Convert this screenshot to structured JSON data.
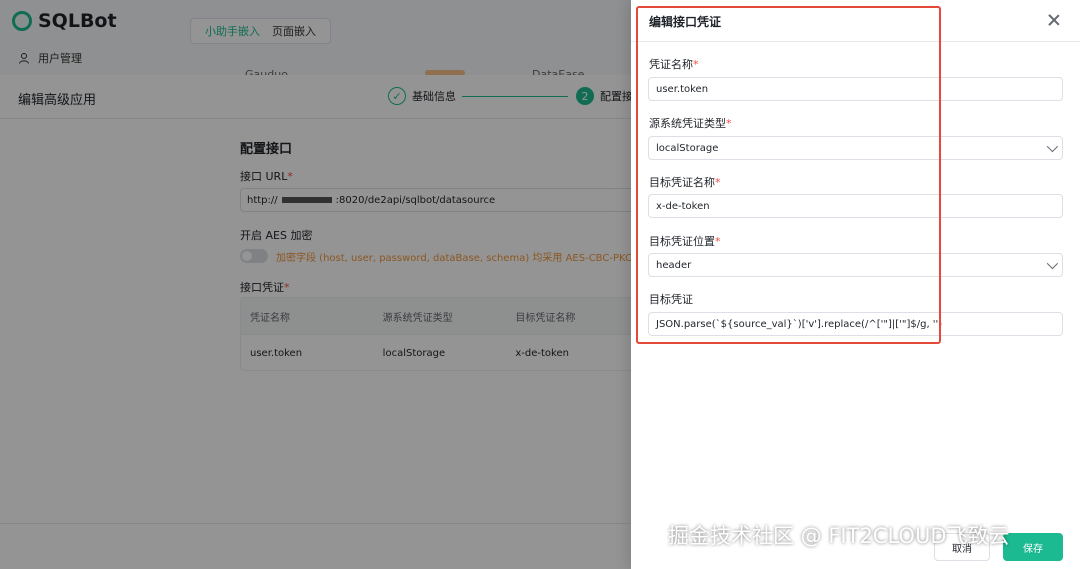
{
  "app": {
    "logo_text": "SQLBot",
    "user_management": "用户管理",
    "embed_tabs": [
      "小助手嵌入",
      "页面嵌入"
    ],
    "peek_texts": [
      "Gauduo",
      "DataEase"
    ]
  },
  "editor": {
    "title": "编辑高级应用",
    "steps": [
      {
        "index": "✓",
        "label": "基础信息"
      },
      {
        "index": "2",
        "label": "配置接"
      }
    ],
    "section_title": "配置接口",
    "url_label": "接口 URL",
    "url_prefix": "http://",
    "url_suffix": ":8020/de2api/sqlbot/datasource",
    "aes_label": "开启 AES 加密",
    "aes_hint": "加密字段 (host, user, password, dataBase, schema) 均采用 AES-CBC-PKC",
    "cred_label": "接口凭证",
    "cred_columns": [
      "凭证名称",
      "源系统凭证类型",
      "目标凭证名称"
    ],
    "cred_rows": [
      [
        "user.token",
        "localStorage",
        "x-de-token"
      ]
    ]
  },
  "drawer": {
    "title": "编辑接口凭证",
    "fields": {
      "cred_name": {
        "label": "凭证名称",
        "value": "user.token"
      },
      "source_type": {
        "label": "源系统凭证类型",
        "value": "localStorage"
      },
      "target_name": {
        "label": "目标凭证名称",
        "value": "x-de-token"
      },
      "target_position": {
        "label": "目标凭证位置",
        "value": "header"
      },
      "target_cred": {
        "label": "目标凭证",
        "value": "JSON.parse(`${source_val}`)['v'].replace(/^['\"]|['\"]$/g, '')"
      }
    },
    "cancel_label": "取消",
    "save_label": "保存"
  },
  "watermark": "掘金技术社区 @ FIT2CLOUD飞致云",
  "colors": {
    "accent": "#1cba90",
    "highlight_frame": "#e34a3a",
    "required": "#f54a45"
  },
  "icons": [
    "close-icon",
    "chevron-down-icon",
    "user-icon",
    "check-circle-icon"
  ]
}
